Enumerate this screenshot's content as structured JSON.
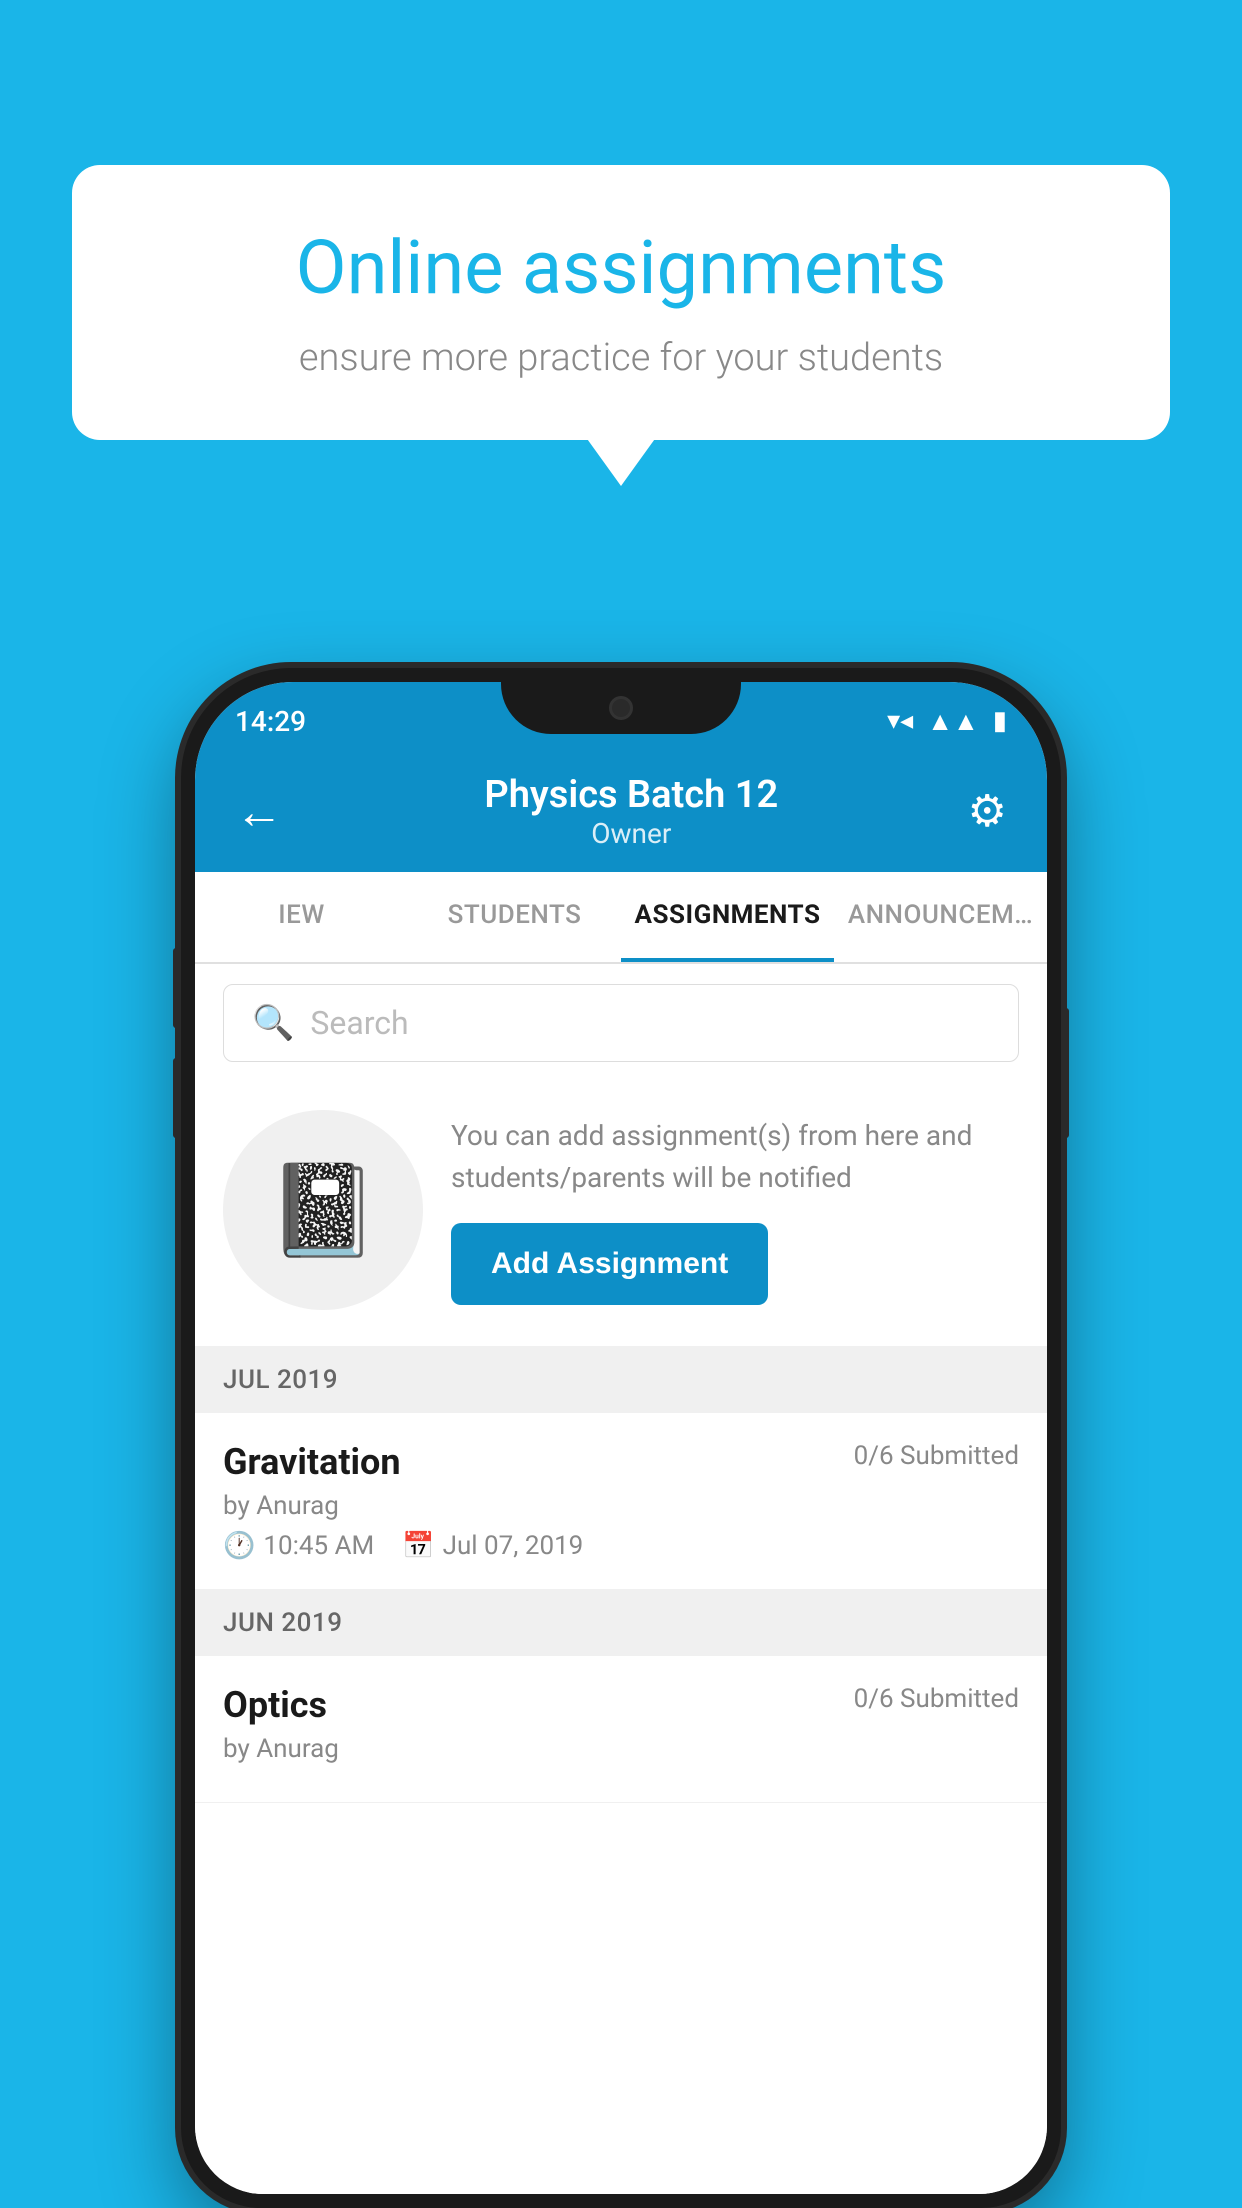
{
  "background": {
    "color": "#1ab5e8"
  },
  "speech_bubble": {
    "title": "Online assignments",
    "subtitle": "ensure more practice for your students"
  },
  "status_bar": {
    "time": "14:29",
    "icons": [
      "wifi",
      "signal",
      "battery"
    ]
  },
  "app_header": {
    "title": "Physics Batch 12",
    "subtitle": "Owner",
    "back_label": "←",
    "settings_label": "⚙"
  },
  "tabs": [
    {
      "label": "IEW",
      "active": false
    },
    {
      "label": "STUDENTS",
      "active": false
    },
    {
      "label": "ASSIGNMENTS",
      "active": true
    },
    {
      "label": "ANNOUNCEM…",
      "active": false
    }
  ],
  "search": {
    "placeholder": "Search"
  },
  "promo_card": {
    "description": "You can add assignment(s) from here and students/parents will be notified",
    "button_label": "Add Assignment"
  },
  "sections": [
    {
      "month_label": "JUL 2019",
      "assignments": [
        {
          "name": "Gravitation",
          "status": "0/6 Submitted",
          "author": "by Anurag",
          "time": "10:45 AM",
          "date": "Jul 07, 2019"
        }
      ]
    },
    {
      "month_label": "JUN 2019",
      "assignments": [
        {
          "name": "Optics",
          "status": "0/6 Submitted",
          "author": "by Anurag",
          "time": "",
          "date": ""
        }
      ]
    }
  ]
}
